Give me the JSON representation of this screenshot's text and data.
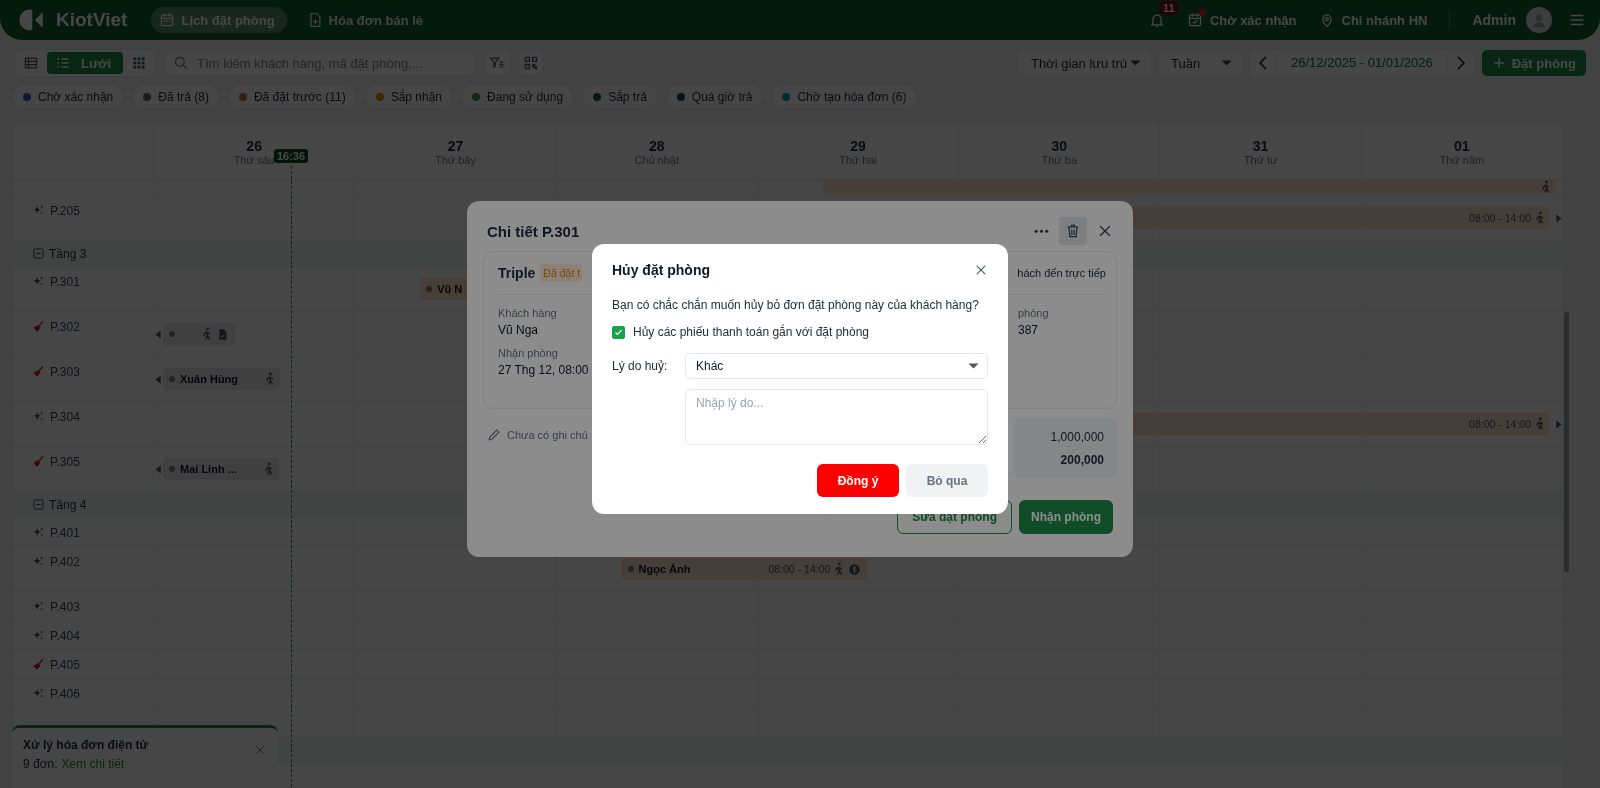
{
  "header": {
    "logo": "KiotViet",
    "tabs": [
      {
        "label": "Lịch đặt phòng",
        "selected": true
      },
      {
        "label": "Hóa đơn bán lẻ",
        "selected": false
      }
    ],
    "notifications": "11",
    "pending": "Chờ xác nhận",
    "branch": "Chi nhánh HN",
    "user": "Admin"
  },
  "toolbar": {
    "views": [
      {
        "kind": "table",
        "selected": false
      },
      {
        "kind": "list",
        "label": "Lưới",
        "selected": true
      },
      {
        "kind": "grid",
        "selected": false
      }
    ],
    "search": {
      "placeholder": "Tìm kiếm khách hàng, mã đặt phòng,..."
    },
    "time_filter": "Thời gian lưu trú",
    "period": "Tuần",
    "date_range": "26/12/2025 - 01/01/2026",
    "book_button": "Đặt phòng"
  },
  "status_chips": [
    {
      "label": "Chờ xác nhận",
      "color": "#081b3b"
    },
    {
      "label": "Đã trả (8)",
      "color": "#191c1f"
    },
    {
      "label": "Đã đặt trước (11)",
      "color": "#37200d"
    },
    {
      "label": "Sắp nhận",
      "color": "#422700"
    },
    {
      "label": "Đang sử dụng",
      "color": "#0d2a14"
    },
    {
      "label": "Sắp trả",
      "color": "#041914"
    },
    {
      "label": "Quá giờ trả",
      "color": "#041417"
    },
    {
      "label": "Chờ tạo hóa đơn (6)",
      "color": "#052c2e"
    }
  ],
  "calendar": {
    "days": [
      {
        "date": "26",
        "weekday": "Thứ sáu"
      },
      {
        "date": "27",
        "weekday": "Thứ bảy"
      },
      {
        "date": "28",
        "weekday": "Chủ nhật"
      },
      {
        "date": "29",
        "weekday": "Thứ hai"
      },
      {
        "date": "30",
        "weekday": "Thứ ba"
      },
      {
        "date": "31",
        "weekday": "Thứ tư"
      },
      {
        "date": "01",
        "weekday": "Thứ năm"
      }
    ],
    "now_marker": "16:36",
    "rows": [
      {
        "kind": "partial",
        "cells": [
          null,
          null,
          null,
          {
            "kind": "row_end",
            "color": "#463e38",
            "from_before": false,
            "to_after": false,
            "walking": true,
            "invoice": false,
            "paid": false
          },
          null,
          null,
          null
        ]
      },
      {
        "kind": "room",
        "room": "P.205",
        "dirty": false,
        "cells": [
          null,
          null,
          null,
          {
            "kind": "row_end",
            "color": "#463e38",
            "time": "08:00 - 14:00",
            "from_before": false,
            "to_after": true,
            "walking": true,
            "invoice": false,
            "paid": false
          },
          null,
          null,
          null
        ]
      },
      {
        "kind": "floor",
        "label": "Tầng 3",
        "expanded": true
      },
      {
        "kind": "room",
        "room": "P.301",
        "dirty": false,
        "cells": [
          null,
          {
            "kind": "same_day",
            "guest": "Vũ N",
            "color": "#463e38",
            "from_before": false,
            "to_after": false,
            "walking": false,
            "invoice": false,
            "paid": false
          },
          null,
          null,
          null,
          null,
          null
        ]
      },
      {
        "kind": "room",
        "room": "P.302",
        "dirty": true,
        "cells": [
          {
            "kind": "same_day",
            "color": "#404041",
            "from_before": true,
            "to_after": false,
            "walking": true,
            "invoice": true,
            "paid": false
          },
          null,
          null,
          null,
          null,
          null,
          null
        ]
      },
      {
        "kind": "room",
        "room": "P.303",
        "dirty": true,
        "cells": [
          {
            "kind": "same_day",
            "guest": "Xuân Hùng",
            "color": "#404041",
            "from_before": true,
            "to_after": false,
            "walking": true,
            "invoice": false,
            "paid": false
          },
          null,
          null,
          null,
          null,
          null,
          null
        ]
      },
      {
        "kind": "room",
        "room": "P.304",
        "dirty": false,
        "cells": [
          null,
          null,
          null,
          {
            "kind": "row_end",
            "color": "#463e38",
            "time": "08:00 - 14:00",
            "from_before": false,
            "to_after": true,
            "walking": true,
            "invoice": false,
            "paid": false
          },
          null,
          null,
          null
        ]
      },
      {
        "kind": "room",
        "room": "P.305",
        "dirty": true,
        "cells": [
          {
            "kind": "same_day",
            "guest": "Mai Linh ...",
            "color": "#404041",
            "from_before": true,
            "to_after": false,
            "walking": true,
            "invoice": false,
            "paid": false
          },
          null,
          null,
          null,
          null,
          null,
          null
        ]
      },
      {
        "kind": "floor",
        "label": "Tầng 4",
        "expanded": true
      },
      {
        "kind": "room",
        "room": "P.401",
        "dirty": false
      },
      {
        "kind": "room",
        "room": "P.402",
        "dirty": false,
        "cells": [
          null,
          null,
          {
            "kind": "next_day",
            "guest": "Ngọc Ánh",
            "color": "#463e38",
            "time": "08:00 - 14:00",
            "from_before": false,
            "to_after": false,
            "walking": true,
            "invoice": false,
            "paid": true
          },
          null,
          null,
          null,
          null
        ]
      },
      {
        "kind": "room",
        "room": "P.403",
        "dirty": false
      },
      {
        "kind": "room",
        "room": "P.404",
        "dirty": false
      },
      {
        "kind": "room",
        "room": "P.405",
        "dirty": true
      },
      {
        "kind": "room",
        "room": "P.406",
        "dirty": false
      },
      {
        "kind": "room"
      },
      {
        "kind": "floor"
      }
    ]
  },
  "notice": {
    "title": "Xử lý hóa đơn điện tử",
    "text": "9 đơn.",
    "link": "Xem chi tiết"
  },
  "detail": {
    "title": "Chi tiết P.301",
    "actions": [
      {
        "kind": "more",
        "selected": false
      },
      {
        "kind": "delete",
        "selected": true
      },
      {
        "kind": "close",
        "selected": false
      }
    ],
    "room_type": "Triple",
    "status": "Đã đặt t",
    "source": "hách đến trực tiếp",
    "fields_left": [
      {
        "label": "Khách hàng",
        "value": "Vũ Nga"
      },
      {
        "label": "Nhận phòng",
        "value": "27 Thg 12, 08:00"
      }
    ],
    "fields_right": [
      {
        "label": "phòng",
        "value": "387"
      }
    ],
    "note": "Chưa có ghi chú",
    "amounts": [
      {
        "value": "1,000,000",
        "strong": false
      },
      {
        "value": "200,000",
        "strong": true
      }
    ],
    "buttons": [
      {
        "label": "Sửa đặt phòng",
        "kind": "secondary"
      },
      {
        "label": "Nhận phòng",
        "kind": "primary"
      }
    ]
  },
  "cancel_dialog": {
    "title": "Hủy đặt phòng",
    "message": "Bạn có chắc chắn muốn hủy bỏ đơn đặt phòng này của khách hàng?",
    "option": {
      "label": "Hủy các phiếu thanh toán gắn với đặt phòng",
      "checked": true
    },
    "reason_label": "Lý do huỷ:",
    "reason": "Khác",
    "note": {
      "placeholder": "Nhập lý do..."
    },
    "buttons": [
      {
        "label": "Đồng ý",
        "kind": "danger"
      },
      {
        "label": "Bỏ qua",
        "kind": "cancel"
      }
    ]
  }
}
